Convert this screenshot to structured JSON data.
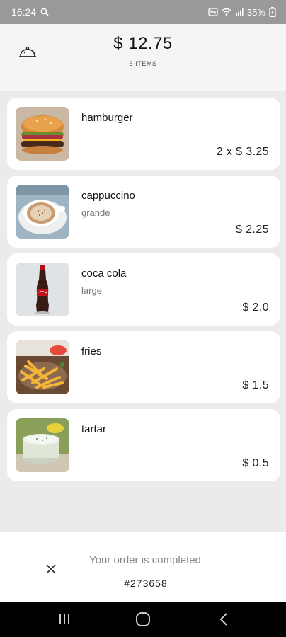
{
  "status_bar": {
    "time": "16:24",
    "battery": "35%"
  },
  "header": {
    "total": "$ 12.75",
    "items_count": "6 ITEMS"
  },
  "items": [
    {
      "name": "hamburger",
      "option": "",
      "price": "2 x $ 3.25",
      "image": "hamburger"
    },
    {
      "name": "cappuccino",
      "option": "grande",
      "price": "$ 2.25",
      "image": "cappuccino"
    },
    {
      "name": "coca cola",
      "option": "large",
      "price": "$ 2.0",
      "image": "coca-cola"
    },
    {
      "name": "fries",
      "option": "",
      "price": "$ 1.5",
      "image": "fries"
    },
    {
      "name": "tartar",
      "option": "",
      "price": "$ 0.5",
      "image": "tartar"
    }
  ],
  "order": {
    "status_text": "Your order is completed",
    "number": "#273658"
  },
  "icons": {
    "bell": "bell-icon",
    "close": "close-icon",
    "search": "search-icon"
  },
  "colors": {
    "status_bar": "#999999",
    "background": "#ebebeb",
    "card": "#ffffff"
  }
}
